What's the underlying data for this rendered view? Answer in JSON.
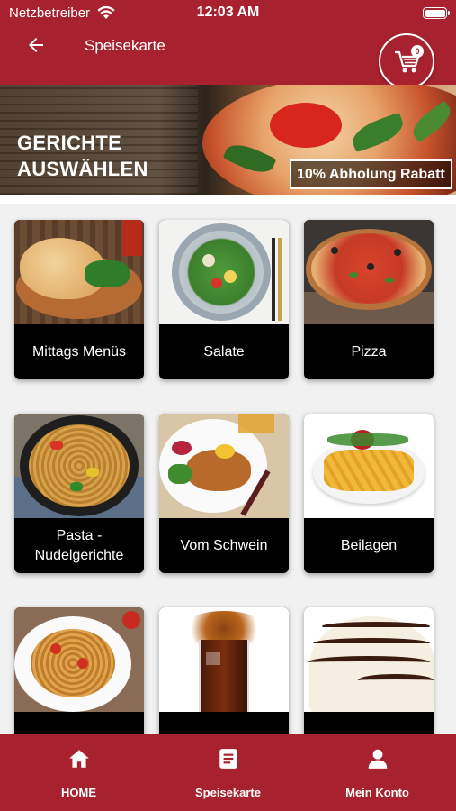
{
  "status_bar": {
    "carrier": "Netzbetreiber",
    "time": "12:03 AM"
  },
  "header": {
    "title": "Speisekarte",
    "cart_count": "0"
  },
  "banner": {
    "heading_line1": "GERICHTE",
    "heading_line2": "AUSWÄHLEN",
    "badge": "10% Abholung Rabatt"
  },
  "categories": [
    {
      "label": "Mittags Menüs",
      "image": "calzone-salad"
    },
    {
      "label": "Salate",
      "image": "salad-bowl"
    },
    {
      "label": "Pizza",
      "image": "pizza"
    },
    {
      "label": "Pasta - Nudelgerichte",
      "image": "pasta-pan"
    },
    {
      "label": "Vom Schwein",
      "image": "schnitzel-plate"
    },
    {
      "label": "Beilagen",
      "image": "french-fries"
    },
    {
      "label": "",
      "image": "spaghetti-plate"
    },
    {
      "label": "",
      "image": "cola-splash"
    },
    {
      "label": "",
      "image": "ice-cream-dessert"
    }
  ],
  "bottom_nav": [
    {
      "label": "HOME",
      "icon": "home-icon"
    },
    {
      "label": "Speisekarte",
      "icon": "menu-book-icon"
    },
    {
      "label": "Mein Konto",
      "icon": "account-icon"
    }
  ],
  "colors": {
    "brand": "#a8212f",
    "card": "#000000",
    "background": "#f1f1f1"
  }
}
